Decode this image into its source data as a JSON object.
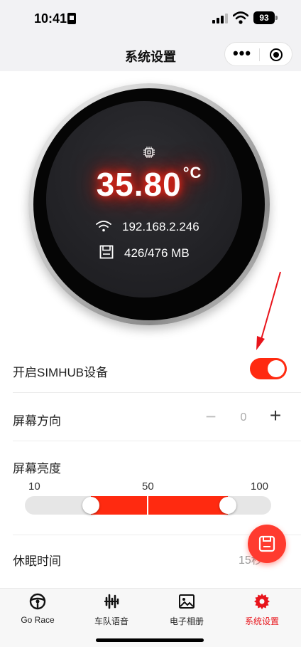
{
  "status_bar": {
    "time": "10:41",
    "battery": "93"
  },
  "navbar": {
    "title": "系统设置",
    "more_icon": "more-dots-icon",
    "target_icon": "target-icon"
  },
  "dial": {
    "chip_icon": "chip-icon",
    "temperature": "35.80",
    "temperature_unit": "°C",
    "ip_icon": "wifi-icon",
    "ip": "192.168.2.246",
    "memory_icon": "save-icon",
    "memory": "426/476 MB"
  },
  "settings": {
    "simhub": {
      "label": "开启SIMHUB设备",
      "enabled": true
    },
    "orientation": {
      "label": "屏幕方向",
      "value": "0",
      "minus": "−",
      "plus": "+"
    },
    "brightness": {
      "label": "屏幕亮度",
      "ticks": [
        "10",
        "50",
        "100"
      ],
      "range_low": 25,
      "range_high": 85
    },
    "sleep": {
      "label": "休眠时间",
      "value": "15秒"
    }
  },
  "fab": {
    "icon": "save-icon"
  },
  "tabbar": {
    "tabs": [
      {
        "label": "Go Race",
        "icon": "steering-wheel-icon",
        "active": false
      },
      {
        "label": "车队语音",
        "icon": "audio-wave-icon",
        "active": false
      },
      {
        "label": "电子相册",
        "icon": "image-icon",
        "active": false
      },
      {
        "label": "系统设置",
        "icon": "gear-icon",
        "active": true
      }
    ]
  },
  "colors": {
    "accent": "#ff2a10",
    "active_tab": "#e8141b",
    "glow": "#ff1a0a"
  }
}
